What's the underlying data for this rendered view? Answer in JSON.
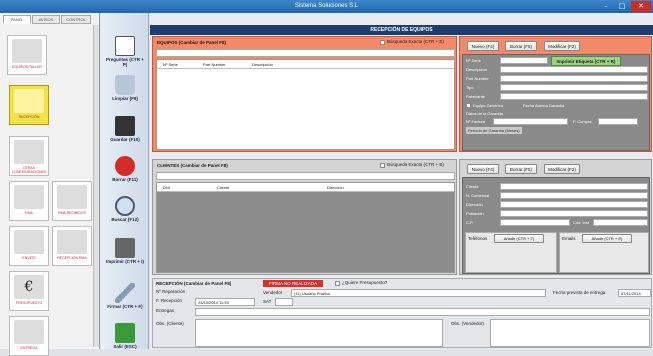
{
  "window": {
    "title": "Sistema Soluciones S.L"
  },
  "left_tabs": [
    "PANEL",
    "AVISOS",
    "CONTROL"
  ],
  "left_modules": [
    {
      "label": "EQUIPOS/TALLER"
    },
    {
      "label": "RECEPCIÓN"
    },
    {
      "label": "OTRAS CONFIGURACIONES"
    },
    {
      "label": "RMA"
    },
    {
      "label": "RMA RECIBIDOS"
    },
    {
      "label": "ENVÍOS"
    },
    {
      "label": "RECEPCIÓN RMA"
    },
    {
      "label": "PRESUPUESTO"
    },
    {
      "label": "ENTREGA"
    }
  ],
  "toolbar": [
    {
      "label": "Preguntas (CTR + P)",
      "icon": "document-icon"
    },
    {
      "label": "Limpiar (F9)",
      "icon": "bin-icon"
    },
    {
      "label": "Guardar (F10)",
      "icon": "save-icon"
    },
    {
      "label": "Borrar (F11)",
      "icon": "delete-icon"
    },
    {
      "label": "Buscar (F12)",
      "icon": "search-icon"
    },
    {
      "label": "Imprimir (CTR + I)",
      "icon": "printer-icon"
    },
    {
      "label": "Firmar (CTR + F)",
      "icon": "pen-icon"
    },
    {
      "label": "Salir (ESC)",
      "icon": "exit-icon"
    }
  ],
  "header": {
    "title": "RECEPCIÓN DE EQUIPOS"
  },
  "equipos": {
    "title": "EQUIPOS (Cambiar de Panel F8)",
    "exact_search": "Búsqueda Exacta (CTR + E)",
    "columns": [
      "Nº Serie",
      "Part Number",
      "Descripción"
    ],
    "buttons": [
      "Nuevo (F4)",
      "Borrar (F5)",
      "Modificar (F2)"
    ],
    "print_label": "Imprimir Etiqueta (CTR + R)",
    "fields": [
      "Nº Serie",
      "Descripción",
      "Part Number",
      "Tipo",
      "Fabricante"
    ],
    "generic_check": "Equipo Genérico",
    "generic_hint": "Fecha Alarma Garantía",
    "warranty_label": "Datos de la Garantía",
    "nf_label": "Nº Factura",
    "compra_label": "F. Compra",
    "period_label": "Periodo de Garantía (Meses)"
  },
  "clientes": {
    "title": "CLIENTES (Cambiar de Panel F8)",
    "exact_search": "Búsqueda Exacta (CTR + B)",
    "columns": [
      "DNI",
      "Cliente",
      "Dirección"
    ],
    "buttons": [
      "Nuevo (F4)",
      "Borrar (F5)",
      "Modificar (F2)"
    ],
    "fields": [
      "Cliente",
      "N. Comercial",
      "Dirección",
      "Población",
      "C.P."
    ],
    "cp_extra": "Cód. Inst",
    "telefono_label": "Teléfonos",
    "telefono_add": "Añadir (CTR + T)",
    "email_label": "Emails",
    "email_add": "Añadir (CTR + E)"
  },
  "recepcion": {
    "title": "RECEPCIÓN (Cambiar de Panel F8)",
    "status_badge": "FIRMA NO REALIZADA",
    "presupuesto_check": "¿Quiere Presupuesto?",
    "rep_label": "Nº Reparación",
    "vendedor_label": "Vendedor",
    "vendedor_value": "(11) Usuario Prueba",
    "fecha_prev_label": "Fecha prevista de entrega",
    "fecha_prev_value": "07/11/2014",
    "frecep_label": "F. Recepción",
    "frecep_value": "24/10/2014 11:59",
    "sat_label": "SAT",
    "entregas_label": "Entregas",
    "obs_cliente": "Obs. (Cliente)",
    "obs_vendedor": "Obs. (Vendedor)"
  }
}
